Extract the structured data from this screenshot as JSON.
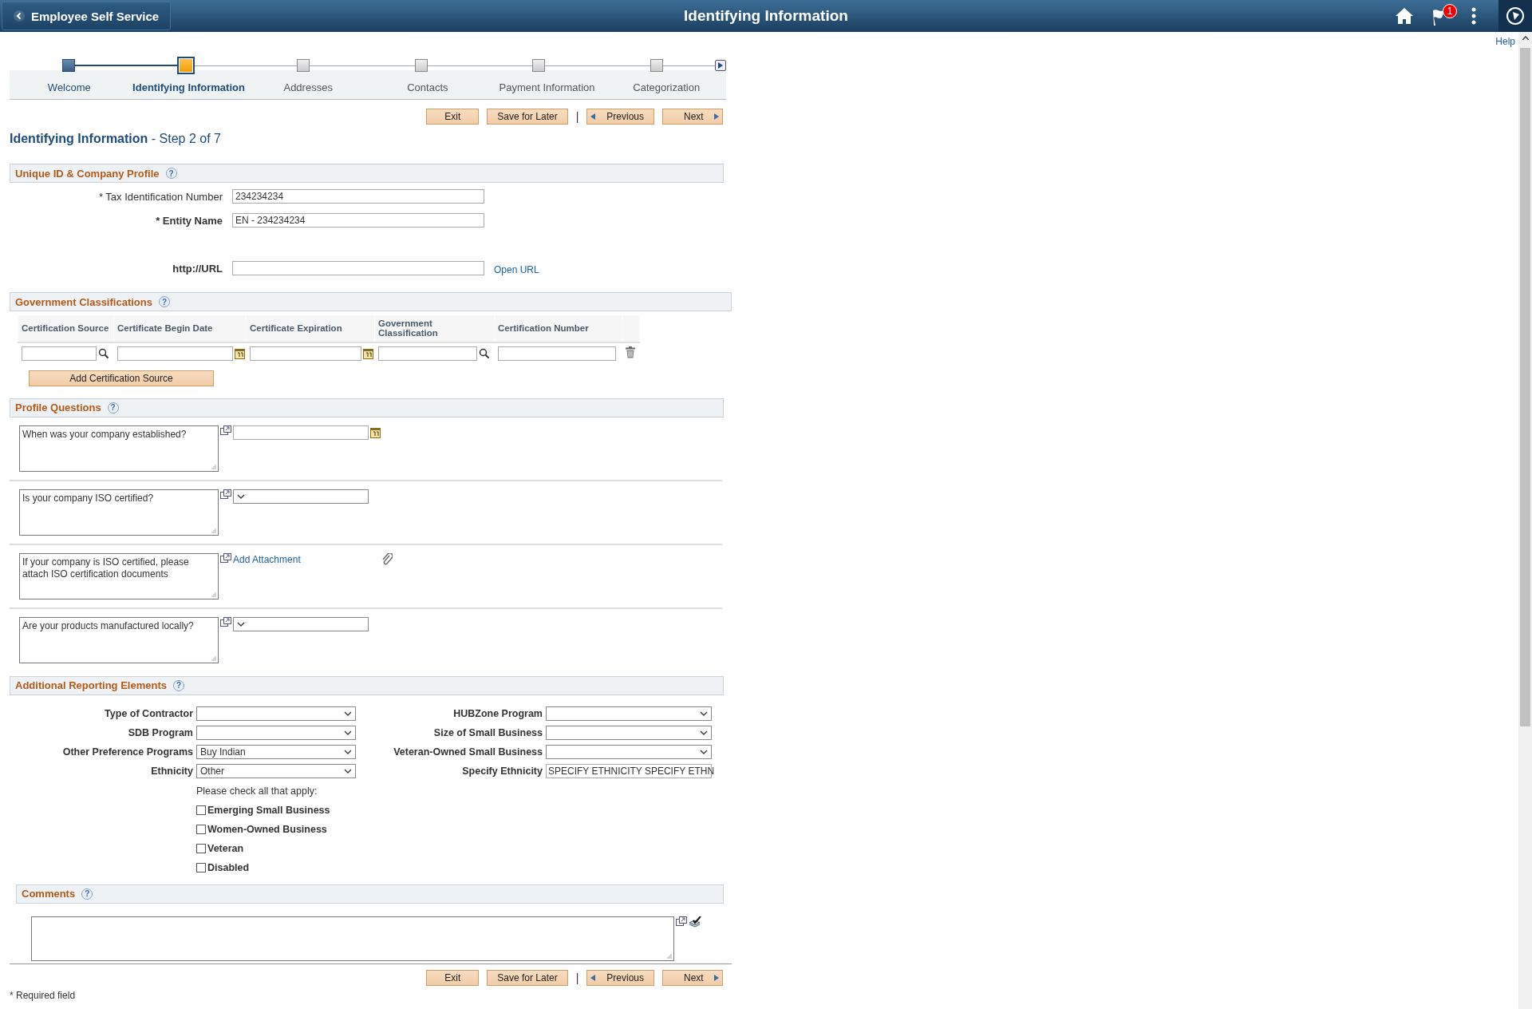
{
  "header": {
    "back_button": "Employee Self Service",
    "title": "Identifying Information",
    "notification_count": "1"
  },
  "help_link": "Help",
  "steps": [
    {
      "label": "Welcome",
      "completed": true,
      "selected": false
    },
    {
      "label": "Identifying Information",
      "completed": false,
      "selected": true
    },
    {
      "label": "Addresses",
      "completed": false,
      "selected": false
    },
    {
      "label": "Contacts",
      "completed": false,
      "selected": false
    },
    {
      "label": "Payment Information",
      "completed": false,
      "selected": false
    },
    {
      "label": "Categorization",
      "completed": false,
      "selected": false
    }
  ],
  "nav_buttons": [
    {
      "label": "Exit",
      "kind": "plain"
    },
    {
      "label": "Save for Later",
      "kind": "plain"
    },
    {
      "label": "Previous",
      "kind": "previous",
      "separator": "|"
    },
    {
      "label": "Next",
      "kind": "next"
    }
  ],
  "page_heading": {
    "title": "Identifying Information",
    "step": "- Step 2 of 7"
  },
  "unique_id_section": {
    "title": "Unique ID & Company Profile",
    "help_icon": "?",
    "fields": [
      {
        "label": "* Tax Identification Number",
        "emphasis": false,
        "value": "234234234"
      },
      {
        "label": "* Entity Name",
        "emphasis": true,
        "value": "EN - 234234234"
      },
      {
        "label": "http://URL",
        "emphasis": true,
        "link": "Open URL"
      }
    ]
  },
  "government_section": {
    "title": "Government Classifications",
    "help_icon": "?",
    "columns": [
      "Certification Source",
      "Certificate Begin Date",
      "Certificate Expiration",
      "Government Classification",
      "Certification Number"
    ],
    "row": [
      {
        "kind": "lookup"
      },
      {
        "kind": "date"
      },
      {
        "kind": "date"
      },
      {
        "kind": "lookup"
      },
      {
        "kind": "text"
      }
    ],
    "add_button": "Add Certification Source"
  },
  "profile_section": {
    "title": "Profile Questions",
    "help_icon": "?",
    "questions": [
      {
        "text": "When was your company established?",
        "kind": "date"
      },
      {
        "text": "Is your company ISO certified?",
        "kind": "select"
      },
      {
        "text": "If your company is ISO certified, please attach ISO certification documents",
        "kind": "attachment",
        "link": "Add Attachment"
      },
      {
        "text": "Are your products manufactured locally?",
        "kind": "select"
      }
    ]
  },
  "additional_section": {
    "title": "Additional Reporting Elements",
    "help_icon": "?",
    "left_fields": [
      {
        "label": "Type of Contractor",
        "kind": "select"
      },
      {
        "label": "SDB Program",
        "kind": "select"
      },
      {
        "label": "Other Preference Programs",
        "kind": "select",
        "value": "Buy Indian"
      },
      {
        "label": "Ethnicity",
        "kind": "select",
        "value": "Other"
      }
    ],
    "right_fields": [
      {
        "label": "HUBZone Program",
        "kind": "select"
      },
      {
        "label": "Size of Small Business",
        "kind": "select"
      },
      {
        "label": "Veteran-Owned Small Business",
        "kind": "select"
      },
      {
        "label": "Specify Ethnicity",
        "kind": "text",
        "value": "SPECIFY ETHNICITY SPECIFY ETHN"
      }
    ],
    "checklist_prompt": "Please check all that apply:",
    "checkboxes": [
      {
        "label": "Emerging Small Business",
        "checked": false
      },
      {
        "label": "Women-Owned Business",
        "checked": false
      },
      {
        "label": "Veteran",
        "checked": false
      },
      {
        "label": "Disabled",
        "checked": false
      }
    ]
  },
  "comments_section": {
    "title": "Comments",
    "help_icon": "?"
  },
  "bottom_nav_buttons": [
    {
      "label": "Exit",
      "kind": "plain"
    },
    {
      "label": "Save for Later",
      "kind": "plain"
    },
    {
      "label": "Previous",
      "kind": "previous",
      "separator": "|"
    },
    {
      "label": "Next",
      "kind": "next"
    }
  ],
  "footnote": "* Required field"
}
